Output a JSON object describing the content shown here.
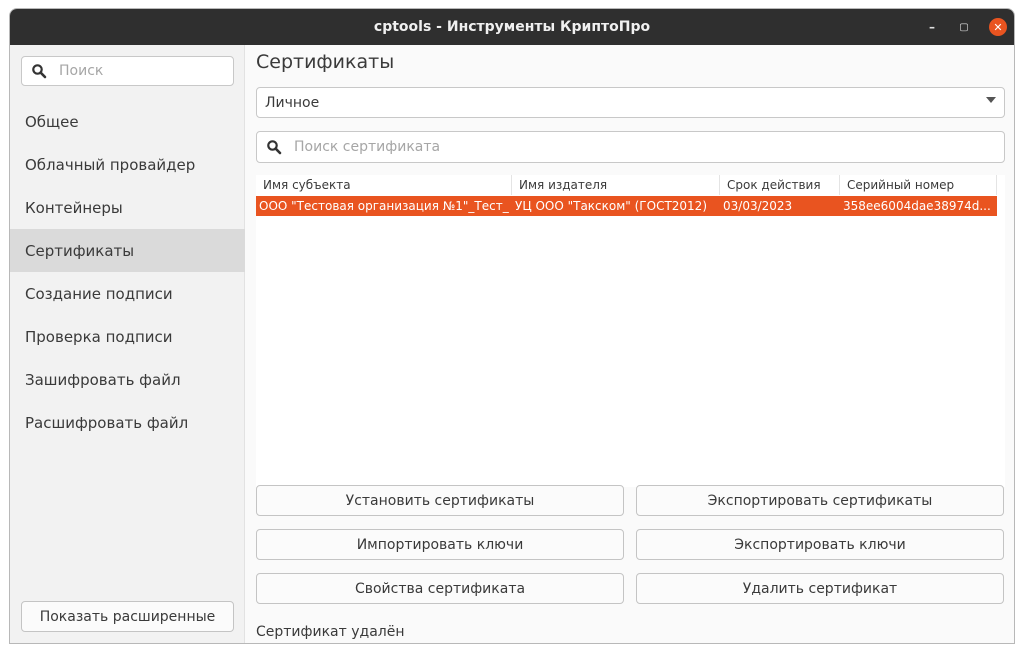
{
  "window": {
    "title": "cptools - Инструменты КриптоПро",
    "controls": {
      "minimize": "–",
      "maximize": "▢",
      "close": "✕"
    }
  },
  "sidebar": {
    "search_placeholder": "Поиск",
    "items": [
      {
        "label": "Общее"
      },
      {
        "label": "Облачный провайдер"
      },
      {
        "label": "Контейнеры"
      },
      {
        "label": "Сертификаты",
        "active": true
      },
      {
        "label": "Создание подписи"
      },
      {
        "label": "Проверка подписи"
      },
      {
        "label": "Зашифровать файл"
      },
      {
        "label": "Расшифровать файл"
      }
    ],
    "advanced_button": "Показать расширенные"
  },
  "main": {
    "title": "Сертификаты",
    "store_select": "Личное",
    "search_placeholder": "Поиск сертификата",
    "table": {
      "columns": [
        "Имя субъекта",
        "Имя издателя",
        "Срок действия",
        "Серийный номер"
      ],
      "rows": [
        {
          "subject": "ООО \"Тестовая организация №1\"_Тест_",
          "issuer": "УЦ ООО \"Такском\" (ГОСТ2012)",
          "expires": "03/03/2023",
          "serial": "358ee6004dae38974d...",
          "selected": true
        }
      ]
    },
    "buttons": {
      "install": "Установить сертификаты",
      "export_certs": "Экспортировать сертификаты",
      "import_keys": "Импортировать ключи",
      "export_keys": "Экспортировать ключи",
      "properties": "Свойства сертификата",
      "delete": "Удалить сертификат"
    },
    "status": "Сертификат удалён"
  },
  "colors": {
    "accent": "#e95420",
    "titlebar": "#2f2f2f",
    "sidebar_bg": "#f2f2f2",
    "sidebar_active": "#dadada"
  },
  "icons": {
    "search": "search-icon",
    "dropdown": "chevron-down-icon"
  }
}
